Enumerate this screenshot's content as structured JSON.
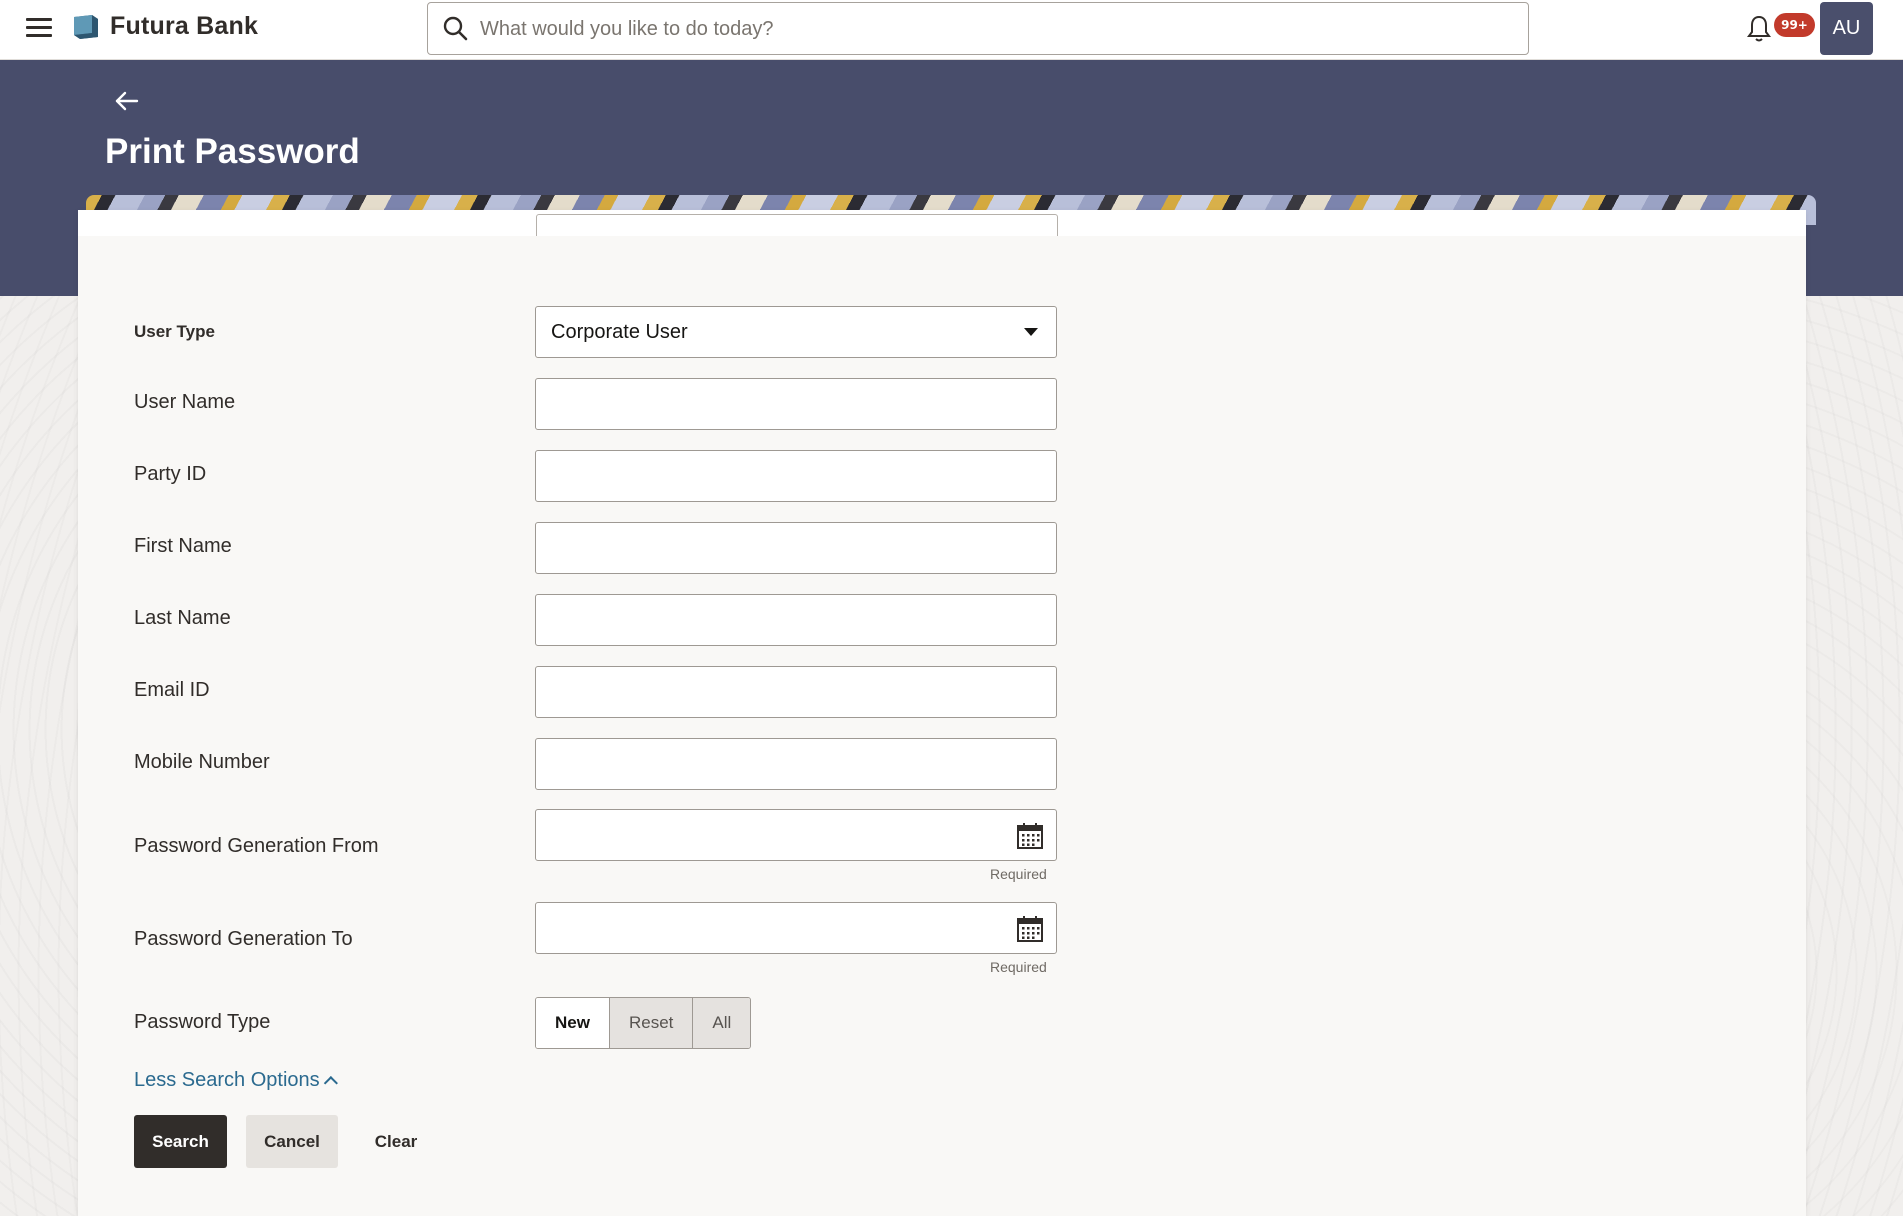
{
  "topbar": {
    "brand": "Futura Bank",
    "search_placeholder": "What would you like to do today?",
    "notification_count": "99+",
    "avatar_initials": "AU"
  },
  "page": {
    "title": "Print Password"
  },
  "form": {
    "user_type": {
      "label": "User Type",
      "value": "Corporate User"
    },
    "user_name": {
      "label": "User Name",
      "value": ""
    },
    "party_id": {
      "label": "Party ID",
      "value": ""
    },
    "first_name": {
      "label": "First Name",
      "value": ""
    },
    "last_name": {
      "label": "Last Name",
      "value": ""
    },
    "email_id": {
      "label": "Email ID",
      "value": ""
    },
    "mobile_number": {
      "label": "Mobile Number",
      "value": ""
    },
    "password_from": {
      "label": "Password Generation From",
      "value": "",
      "hint": "Required"
    },
    "password_to": {
      "label": "Password Generation To",
      "value": "",
      "hint": "Required"
    },
    "password_type": {
      "label": "Password Type",
      "options": [
        "New",
        "Reset",
        "All"
      ],
      "selected": "New"
    },
    "less_options_link": "Less Search Options"
  },
  "actions": {
    "search": "Search",
    "cancel": "Cancel",
    "clear": "Clear"
  }
}
